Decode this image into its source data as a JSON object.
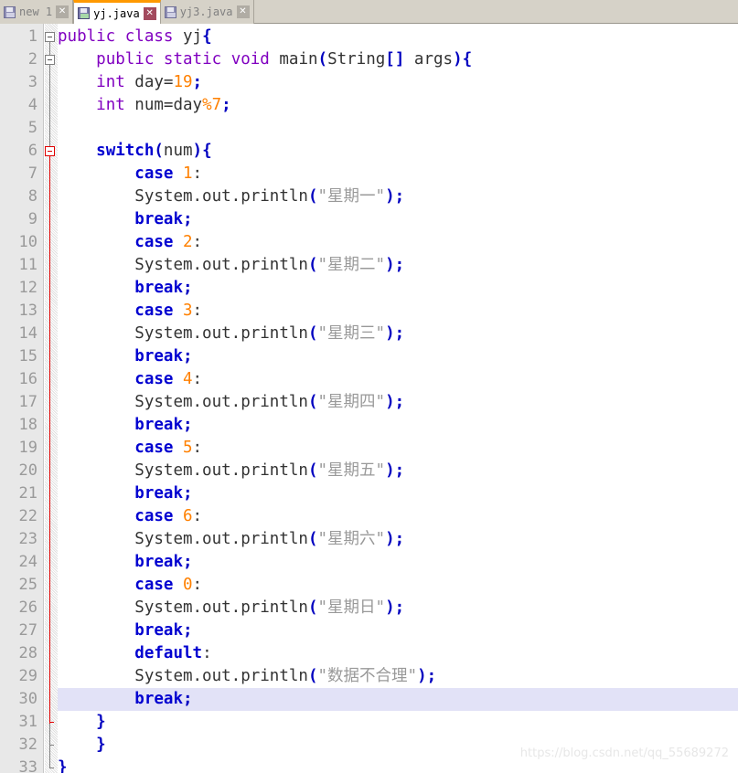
{
  "tabs": [
    {
      "label": "new 1",
      "icon": "floppy-disk-icon",
      "close": "✕",
      "active": false
    },
    {
      "label": "yj.java",
      "icon": "floppy-disk-icon",
      "close": "✕",
      "active": true
    },
    {
      "label": "yj3.java",
      "icon": "floppy-disk-icon",
      "close": "✕",
      "active": false
    }
  ],
  "editor": {
    "current_line": 30,
    "total_lines": 33,
    "line_numbers": [
      "1",
      "2",
      "3",
      "4",
      "5",
      "6",
      "7",
      "8",
      "9",
      "10",
      "11",
      "12",
      "13",
      "14",
      "15",
      "16",
      "17",
      "18",
      "19",
      "20",
      "21",
      "22",
      "23",
      "24",
      "25",
      "26",
      "27",
      "28",
      "29",
      "30",
      "31",
      "32",
      "33"
    ],
    "lines": [
      {
        "n": 1,
        "indent": 0,
        "tokens": [
          {
            "t": "public",
            "c": "kw"
          },
          {
            "t": " ",
            "c": "plain"
          },
          {
            "t": "class",
            "c": "kw"
          },
          {
            "t": " yj",
            "c": "plain"
          },
          {
            "t": "{",
            "c": "op"
          }
        ]
      },
      {
        "n": 2,
        "indent": 1,
        "tokens": [
          {
            "t": "public",
            "c": "kw"
          },
          {
            "t": " ",
            "c": "plain"
          },
          {
            "t": "static",
            "c": "kw"
          },
          {
            "t": " ",
            "c": "plain"
          },
          {
            "t": "void",
            "c": "kw"
          },
          {
            "t": " main",
            "c": "plain"
          },
          {
            "t": "(",
            "c": "op"
          },
          {
            "t": "String",
            "c": "plain"
          },
          {
            "t": "[]",
            "c": "op"
          },
          {
            "t": " args",
            "c": "plain"
          },
          {
            "t": ")",
            "c": "op"
          },
          {
            "t": "{",
            "c": "op"
          }
        ]
      },
      {
        "n": 3,
        "indent": 1,
        "tokens": [
          {
            "t": "int",
            "c": "kw"
          },
          {
            "t": " day=",
            "c": "plain"
          },
          {
            "t": "19",
            "c": "num"
          },
          {
            "t": ";",
            "c": "op"
          }
        ]
      },
      {
        "n": 4,
        "indent": 1,
        "tokens": [
          {
            "t": "int",
            "c": "kw"
          },
          {
            "t": " num=day",
            "c": "plain"
          },
          {
            "t": "%",
            "c": "num"
          },
          {
            "t": "7",
            "c": "num"
          },
          {
            "t": ";",
            "c": "op"
          }
        ]
      },
      {
        "n": 5,
        "indent": 0,
        "tokens": []
      },
      {
        "n": 6,
        "indent": 1,
        "tokens": [
          {
            "t": "switch",
            "c": "kw2"
          },
          {
            "t": "(",
            "c": "op"
          },
          {
            "t": "num",
            "c": "plain"
          },
          {
            "t": ")",
            "c": "op"
          },
          {
            "t": "{",
            "c": "op"
          }
        ]
      },
      {
        "n": 7,
        "indent": 2,
        "tokens": [
          {
            "t": "case",
            "c": "kw2"
          },
          {
            "t": " ",
            "c": "plain"
          },
          {
            "t": "1",
            "c": "num"
          },
          {
            "t": ":",
            "c": "plain"
          }
        ]
      },
      {
        "n": 8,
        "indent": 2,
        "tokens": [
          {
            "t": "System.out.println",
            "c": "plain"
          },
          {
            "t": "(",
            "c": "op"
          },
          {
            "t": "\"星期一\"",
            "c": "str"
          },
          {
            "t": ")",
            "c": "op"
          },
          {
            "t": ";",
            "c": "op"
          }
        ]
      },
      {
        "n": 9,
        "indent": 2,
        "tokens": [
          {
            "t": "break",
            "c": "kw2"
          },
          {
            "t": ";",
            "c": "op"
          }
        ]
      },
      {
        "n": 10,
        "indent": 2,
        "tokens": [
          {
            "t": "case",
            "c": "kw2"
          },
          {
            "t": " ",
            "c": "plain"
          },
          {
            "t": "2",
            "c": "num"
          },
          {
            "t": ":",
            "c": "plain"
          }
        ]
      },
      {
        "n": 11,
        "indent": 2,
        "tokens": [
          {
            "t": "System.out.println",
            "c": "plain"
          },
          {
            "t": "(",
            "c": "op"
          },
          {
            "t": "\"星期二\"",
            "c": "str"
          },
          {
            "t": ")",
            "c": "op"
          },
          {
            "t": ";",
            "c": "op"
          }
        ]
      },
      {
        "n": 12,
        "indent": 2,
        "tokens": [
          {
            "t": "break",
            "c": "kw2"
          },
          {
            "t": ";",
            "c": "op"
          }
        ]
      },
      {
        "n": 13,
        "indent": 2,
        "tokens": [
          {
            "t": "case",
            "c": "kw2"
          },
          {
            "t": " ",
            "c": "plain"
          },
          {
            "t": "3",
            "c": "num"
          },
          {
            "t": ":",
            "c": "plain"
          }
        ]
      },
      {
        "n": 14,
        "indent": 2,
        "tokens": [
          {
            "t": "System.out.println",
            "c": "plain"
          },
          {
            "t": "(",
            "c": "op"
          },
          {
            "t": "\"星期三\"",
            "c": "str"
          },
          {
            "t": ")",
            "c": "op"
          },
          {
            "t": ";",
            "c": "op"
          }
        ]
      },
      {
        "n": 15,
        "indent": 2,
        "tokens": [
          {
            "t": "break",
            "c": "kw2"
          },
          {
            "t": ";",
            "c": "op"
          }
        ]
      },
      {
        "n": 16,
        "indent": 2,
        "tokens": [
          {
            "t": "case",
            "c": "kw2"
          },
          {
            "t": " ",
            "c": "plain"
          },
          {
            "t": "4",
            "c": "num"
          },
          {
            "t": ":",
            "c": "plain"
          }
        ]
      },
      {
        "n": 17,
        "indent": 2,
        "tokens": [
          {
            "t": "System.out.println",
            "c": "plain"
          },
          {
            "t": "(",
            "c": "op"
          },
          {
            "t": "\"星期四\"",
            "c": "str"
          },
          {
            "t": ")",
            "c": "op"
          },
          {
            "t": ";",
            "c": "op"
          }
        ]
      },
      {
        "n": 18,
        "indent": 2,
        "tokens": [
          {
            "t": "break",
            "c": "kw2"
          },
          {
            "t": ";",
            "c": "op"
          }
        ]
      },
      {
        "n": 19,
        "indent": 2,
        "tokens": [
          {
            "t": "case",
            "c": "kw2"
          },
          {
            "t": " ",
            "c": "plain"
          },
          {
            "t": "5",
            "c": "num"
          },
          {
            "t": ":",
            "c": "plain"
          }
        ]
      },
      {
        "n": 20,
        "indent": 2,
        "tokens": [
          {
            "t": "System.out.println",
            "c": "plain"
          },
          {
            "t": "(",
            "c": "op"
          },
          {
            "t": "\"星期五\"",
            "c": "str"
          },
          {
            "t": ")",
            "c": "op"
          },
          {
            "t": ";",
            "c": "op"
          }
        ]
      },
      {
        "n": 21,
        "indent": 2,
        "tokens": [
          {
            "t": "break",
            "c": "kw2"
          },
          {
            "t": ";",
            "c": "op"
          }
        ]
      },
      {
        "n": 22,
        "indent": 2,
        "tokens": [
          {
            "t": "case",
            "c": "kw2"
          },
          {
            "t": " ",
            "c": "plain"
          },
          {
            "t": "6",
            "c": "num"
          },
          {
            "t": ":",
            "c": "plain"
          }
        ]
      },
      {
        "n": 23,
        "indent": 2,
        "tokens": [
          {
            "t": "System.out.println",
            "c": "plain"
          },
          {
            "t": "(",
            "c": "op"
          },
          {
            "t": "\"星期六\"",
            "c": "str"
          },
          {
            "t": ")",
            "c": "op"
          },
          {
            "t": ";",
            "c": "op"
          }
        ]
      },
      {
        "n": 24,
        "indent": 2,
        "tokens": [
          {
            "t": "break",
            "c": "kw2"
          },
          {
            "t": ";",
            "c": "op"
          }
        ]
      },
      {
        "n": 25,
        "indent": 2,
        "tokens": [
          {
            "t": "case",
            "c": "kw2"
          },
          {
            "t": " ",
            "c": "plain"
          },
          {
            "t": "0",
            "c": "num"
          },
          {
            "t": ":",
            "c": "plain"
          }
        ]
      },
      {
        "n": 26,
        "indent": 2,
        "tokens": [
          {
            "t": "System.out.println",
            "c": "plain"
          },
          {
            "t": "(",
            "c": "op"
          },
          {
            "t": "\"星期日\"",
            "c": "str"
          },
          {
            "t": ")",
            "c": "op"
          },
          {
            "t": ";",
            "c": "op"
          }
        ]
      },
      {
        "n": 27,
        "indent": 2,
        "tokens": [
          {
            "t": "break",
            "c": "kw2"
          },
          {
            "t": ";",
            "c": "op"
          }
        ]
      },
      {
        "n": 28,
        "indent": 2,
        "tokens": [
          {
            "t": "default",
            "c": "kw2"
          },
          {
            "t": ":",
            "c": "plain"
          }
        ]
      },
      {
        "n": 29,
        "indent": 2,
        "tokens": [
          {
            "t": "System.out.println",
            "c": "plain"
          },
          {
            "t": "(",
            "c": "op"
          },
          {
            "t": "\"数据不合理\"",
            "c": "str"
          },
          {
            "t": ")",
            "c": "op"
          },
          {
            "t": ";",
            "c": "op"
          }
        ]
      },
      {
        "n": 30,
        "indent": 2,
        "tokens": [
          {
            "t": "break",
            "c": "kw2"
          },
          {
            "t": ";",
            "c": "op"
          }
        ]
      },
      {
        "n": 31,
        "indent": 1,
        "tokens": [
          {
            "t": "}",
            "c": "op"
          }
        ]
      },
      {
        "n": 32,
        "indent": 1,
        "tokens": [
          {
            "t": "}",
            "c": "op"
          }
        ]
      },
      {
        "n": 33,
        "indent": 0,
        "tokens": [
          {
            "t": "}",
            "c": "op"
          }
        ]
      }
    ],
    "fold_markers": [
      {
        "line": 1,
        "color": "gray"
      },
      {
        "line": 2,
        "color": "gray"
      },
      {
        "line": 6,
        "color": "red"
      }
    ]
  },
  "watermark": "https://blog.csdn.net/qq_55689272",
  "colors": {
    "keyword_purple": "#8000c0",
    "keyword_blue": "#0000d0",
    "number_orange": "#ff8000",
    "operator_blue": "#0000c0",
    "string_gray": "#999999",
    "current_line_bg": "#e2e2f7",
    "active_tab_accent": "#ff9900",
    "gutter_bg": "#e8e8e8",
    "tabbar_bg": "#d6d2c8"
  }
}
